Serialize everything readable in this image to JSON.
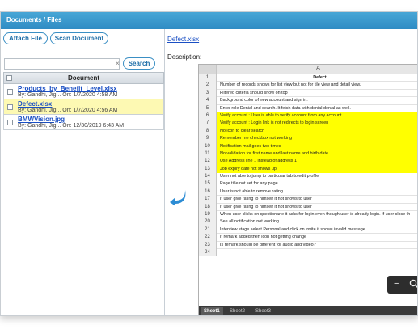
{
  "window": {
    "title": "Documents / Files"
  },
  "toolbar": {
    "attach_label": "Attach File",
    "scan_label": "Scan Document",
    "search_label": "Search"
  },
  "search": {
    "value": "",
    "clear_glyph": "×"
  },
  "documents": {
    "header": "Document",
    "rows": [
      {
        "name": "Products_by_Benefit_Level.xlsx",
        "meta": "By: Gandhi, Jig...  On: 1/7/2020 4:58 AM",
        "selected": false
      },
      {
        "name": "Defect.xlsx",
        "meta": "By: Gandhi, Jig...  On: 1/7/2020 4:56 AM",
        "selected": true
      },
      {
        "name": "BMWVision.jpg",
        "meta": "By: Gandhi, Jig...  On: 12/30/2019 6:43 AM",
        "selected": false
      }
    ]
  },
  "preview": {
    "file_link": "Defect.xlsx",
    "description_label": "Description:",
    "arrow_icon": "curved-arrow-left-icon",
    "accent_color": "#2c8cd4"
  },
  "spreadsheet": {
    "column": "A",
    "highlight_color": "#ffff00",
    "rows": [
      {
        "n": "1",
        "text": "Defect",
        "hl": false,
        "hdr": true
      },
      {
        "n": "2",
        "text": "Number of records shows for list view but not for tile view and detail view.",
        "hl": false
      },
      {
        "n": "3",
        "text": "Filtered criteria should show on top",
        "hl": false
      },
      {
        "n": "4",
        "text": "Background color of new account and sign in.",
        "hl": false
      },
      {
        "n": "5",
        "text": "Enter role Denial and search. It fetch data with denial denial as well.",
        "hl": false
      },
      {
        "n": "6",
        "text": "Verify account : User is able to verify account from any account",
        "hl": true
      },
      {
        "n": "7",
        "text": "Verify account : Login link is not redirects to login screen",
        "hl": true
      },
      {
        "n": "8",
        "text": "No icon to clear search",
        "hl": true
      },
      {
        "n": "9",
        "text": "Remember me checkbox not working",
        "hl": true
      },
      {
        "n": "10",
        "text": "Notification mail goes two times",
        "hl": true
      },
      {
        "n": "11",
        "text": "No validation for first name and last name and birth date",
        "hl": true
      },
      {
        "n": "12",
        "text": "Use Address line 1  instead of address 1",
        "hl": true
      },
      {
        "n": "13",
        "text": "Job expiry date not shows up",
        "hl": true
      },
      {
        "n": "14",
        "text": "User not able to jump to particular tab to edit profile",
        "hl": false
      },
      {
        "n": "15",
        "text": "Page title not set for any page",
        "hl": false
      },
      {
        "n": "16",
        "text": "User is not able to remove rating",
        "hl": false
      },
      {
        "n": "17",
        "text": "If user give rating to himself it not shows to user",
        "hl": false
      },
      {
        "n": "18",
        "text": "If user give rating to himself it not shows to user",
        "hl": false
      },
      {
        "n": "19",
        "text": "When user clicks on questionarie it asks for login even though user is already login. If user close th",
        "hl": false
      },
      {
        "n": "20",
        "text": "See all notification not working",
        "hl": false
      },
      {
        "n": "21",
        "text": "Interview stage select Personal and click on invite it shows invalid message",
        "hl": false
      },
      {
        "n": "22",
        "text": "If remark added then icon not getting change",
        "hl": false
      },
      {
        "n": "23",
        "text": "Is remark should be different for audio and video?",
        "hl": false
      },
      {
        "n": "24",
        "text": "",
        "hl": false
      }
    ],
    "tabs": [
      {
        "label": "Sheet1",
        "active": true
      },
      {
        "label": "Sheet2",
        "active": false
      },
      {
        "label": "Sheet3",
        "active": false
      }
    ],
    "zoom": {
      "minus_glyph": "−",
      "zoom_icon": "magnifier-icon"
    }
  }
}
